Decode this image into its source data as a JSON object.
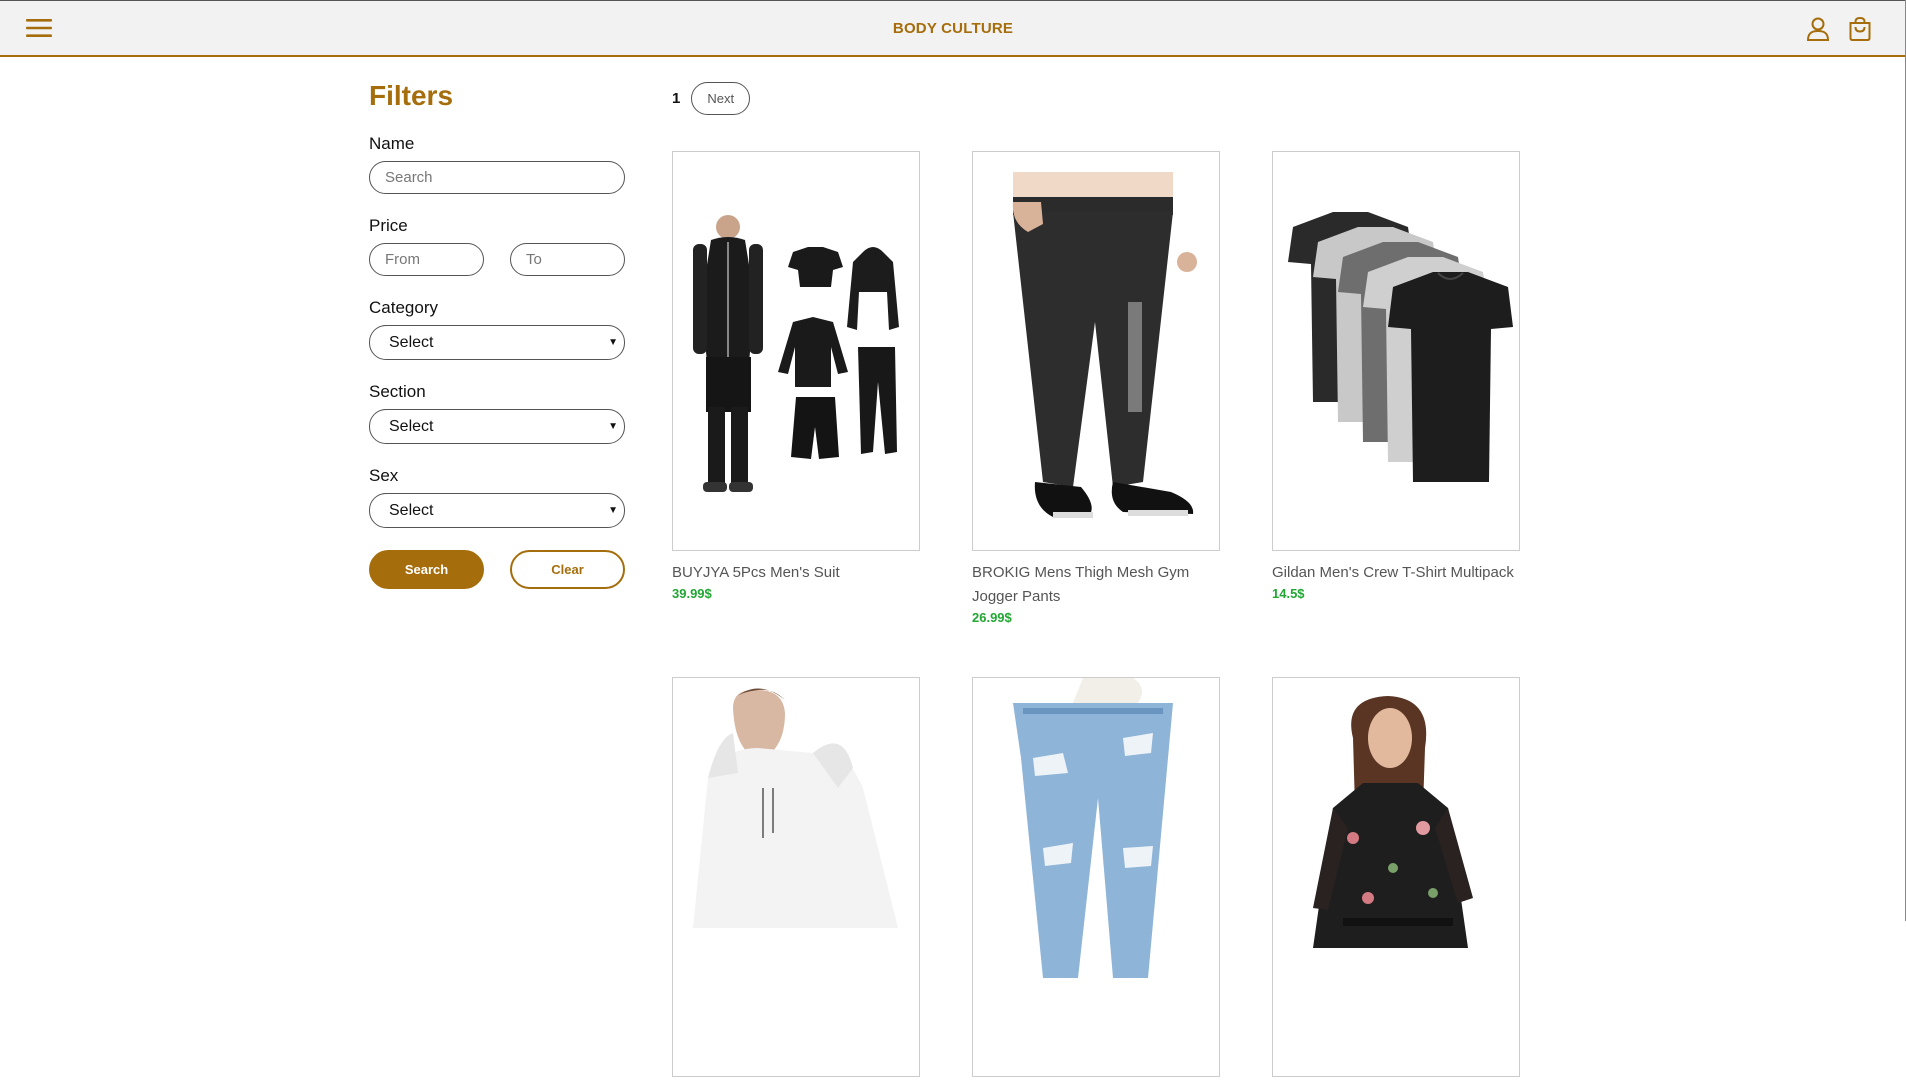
{
  "header": {
    "brand": "BODY CULTURE",
    "menu_icon": "hamburger-menu-icon",
    "user_icon": "user-icon",
    "cart_icon": "shopping-bag-icon",
    "accent_color": "#a56d0b"
  },
  "filters": {
    "title": "Filters",
    "name": {
      "label": "Name",
      "placeholder": "Search",
      "value": ""
    },
    "price": {
      "label": "Price",
      "from_placeholder": "From",
      "to_placeholder": "To"
    },
    "category": {
      "label": "Category",
      "selected": "Select"
    },
    "section": {
      "label": "Section",
      "selected": "Select"
    },
    "sex": {
      "label": "Sex",
      "selected": "Select"
    },
    "search_button": "Search",
    "clear_button": "Clear"
  },
  "pagination": {
    "current_page": "1",
    "next_label": "Next"
  },
  "products": [
    {
      "name": "BUYJYA 5Pcs Men's Suit",
      "price": "39.99$"
    },
    {
      "name": "BROKIG Mens Thigh Mesh Gym Jogger Pants",
      "price": "26.99$"
    },
    {
      "name": "Gildan Men's Crew T-Shirt Multipack",
      "price": "14.5$"
    },
    {
      "name": "",
      "price": ""
    },
    {
      "name": "",
      "price": ""
    },
    {
      "name": "",
      "price": ""
    }
  ],
  "colors": {
    "accent": "#a56d0b",
    "price": "#22a634",
    "header_bg": "#f2f2f2"
  }
}
